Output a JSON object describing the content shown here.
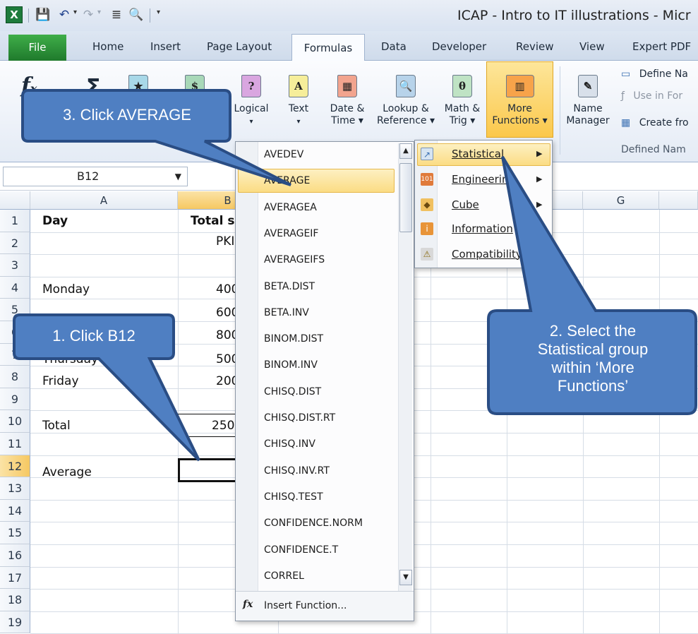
{
  "window": {
    "title": "ICAP - Intro to IT illustrations - Micr",
    "app_logo": "X"
  },
  "ribbon_tabs": {
    "file": "File",
    "home": "Home",
    "insert": "Insert",
    "page_layout": "Page Layout",
    "formulas": "Formulas",
    "data": "Data",
    "developer": "Developer",
    "review": "Review",
    "view": "View",
    "expert_pdf": "Expert PDF"
  },
  "ribbon": {
    "logical": "Logical",
    "text": "Text",
    "date_time_1": "Date &",
    "date_time_2": "Time ▾",
    "lookup_1": "Lookup &",
    "lookup_2": "Reference ▾",
    "math_1": "Math &",
    "math_2": "Trig ▾",
    "more_1": "More",
    "more_2": "Functions ▾",
    "name_mgr_1": "Name",
    "name_mgr_2": "Manager",
    "define_name": "Define Na",
    "use_in_formula": "Use in For",
    "create_from": "Create fro",
    "defined_names_group": "Defined Nam"
  },
  "formula_bar": {
    "name_box": "B12"
  },
  "sheet": {
    "columns": [
      "A",
      "B",
      "G"
    ],
    "rows": [
      "1",
      "2",
      "3",
      "4",
      "5",
      "6",
      "7",
      "8",
      "9",
      "10",
      "11",
      "12",
      "13",
      "14",
      "15",
      "16",
      "17",
      "18",
      "19"
    ],
    "cells": {
      "a1": "Day",
      "b1": "Total s",
      "b2": "PKI",
      "a4": "Monday",
      "b4": "400",
      "b5": "600",
      "b6": "800",
      "a7": "Thursday",
      "b7": "500",
      "a8": "Friday",
      "b8": "200",
      "a10": "Total",
      "b10": "250",
      "a12": "Average"
    }
  },
  "function_list": {
    "items": [
      "AVEDEV",
      "AVERAGE",
      "AVERAGEA",
      "AVERAGEIF",
      "AVERAGEIFS",
      "BETA.DIST",
      "BETA.INV",
      "BINOM.DIST",
      "BINOM.INV",
      "CHISQ.DIST",
      "CHISQ.DIST.RT",
      "CHISQ.INV",
      "CHISQ.INV.RT",
      "CHISQ.TEST",
      "CONFIDENCE.NORM",
      "CONFIDENCE.T",
      "CORREL"
    ],
    "insert_function": "Insert Function..."
  },
  "more_functions_menu": {
    "items": [
      "Statistical",
      "Engineering",
      "Cube",
      "Information",
      "Compatibility"
    ]
  },
  "callouts": {
    "step1": "1. Click B12",
    "step2_line1": "2. Select the",
    "step2_line2": "Statistical group",
    "step2_line3": "within ‘More",
    "step2_line4": "Functions’",
    "step3": "3. Click AVERAGE"
  },
  "colors": {
    "callout_fill": "#4f7fc2",
    "callout_border": "#2a4d84",
    "highlight": "#fbdc84",
    "file_tab": "#2f9a3c"
  }
}
